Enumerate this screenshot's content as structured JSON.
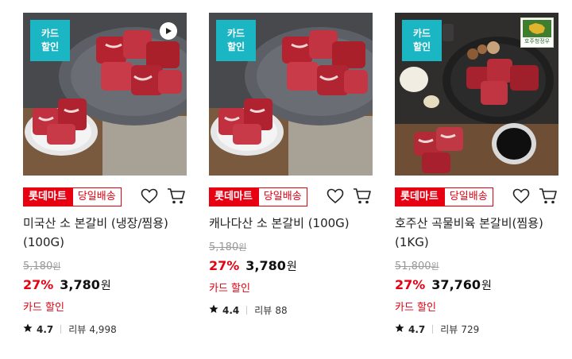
{
  "products": [
    {
      "badge": "카드\n할인",
      "badge_line1": "카드",
      "badge_line2": "할인",
      "mart_tag": "롯데마트",
      "ship_tag": "당일배송",
      "title": "미국산 소 본갈비 (냉장/찜용) (100G)",
      "original_price": "5,180",
      "original_unit": "원",
      "discount": "27%",
      "price": "3,780",
      "price_unit": "원",
      "card_sale": "카드 할인",
      "rating": "4.7",
      "review_label": "리뷰",
      "review_count": "4,998",
      "has_play": true
    },
    {
      "badge_line1": "카드",
      "badge_line2": "할인",
      "mart_tag": "롯데마트",
      "ship_tag": "당일배송",
      "title": "캐나다산 소 본갈비 (100G)",
      "original_price": "5,180",
      "original_unit": "원",
      "discount": "27%",
      "price": "3,780",
      "price_unit": "원",
      "card_sale": "카드 할인",
      "rating": "4.4",
      "review_label": "리뷰",
      "review_count": "88"
    },
    {
      "badge_line1": "카드",
      "badge_line2": "할인",
      "cert_text": "호주청정우",
      "mart_tag": "롯데마트",
      "ship_tag": "당일배송",
      "title": "호주산 곡물비육 본갈비(찜용) (1KG)",
      "original_price": "51,800",
      "original_unit": "원",
      "discount": "27%",
      "price": "37,760",
      "price_unit": "원",
      "card_sale": "카드 할인",
      "rating": "4.7",
      "review_label": "리뷰",
      "review_count": "729"
    }
  ],
  "colors": {
    "accent_red": "#e60012",
    "badge_teal": "#1bb6c4"
  },
  "icons": {
    "wishlist": "heart-icon",
    "cart": "cart-icon",
    "rating": "star-icon",
    "video": "play-icon"
  }
}
